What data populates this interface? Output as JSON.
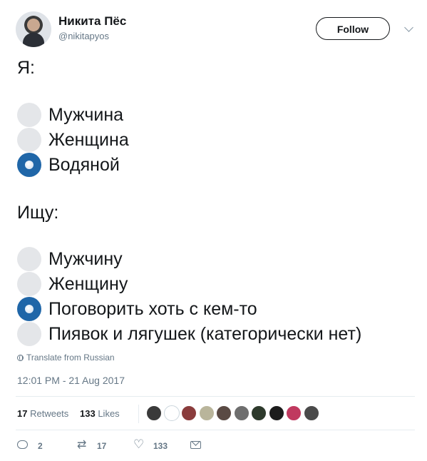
{
  "author": {
    "display_name": "Никита Пёс",
    "handle": "@nikitapyos",
    "follow_label": "Follow"
  },
  "tweet": {
    "heading_1": "Я:",
    "group_1": [
      {
        "label": "Мужчина",
        "checked": false
      },
      {
        "label": "Женщина",
        "checked": false
      },
      {
        "label": "Водяной",
        "checked": true
      }
    ],
    "heading_2": "Ищу:",
    "group_2": [
      {
        "label": "Мужчину",
        "checked": false
      },
      {
        "label": "Женщину",
        "checked": false
      },
      {
        "label": "Поговорить хоть с кем-то",
        "checked": true
      },
      {
        "label": "Пиявок и лягушек (категорически нет)",
        "checked": false
      }
    ],
    "translate_label": "Translate from Russian",
    "timestamp": "12:01 PM - 21 Aug 2017"
  },
  "stats": {
    "retweets_count": "17",
    "retweets_label": "Retweets",
    "likes_count": "133",
    "likes_label": "Likes",
    "likers_colors": [
      "#3a3a3a",
      "#ffffff",
      "#8a3c3c",
      "#b9b59b",
      "#5a4a44",
      "#6e6e6e",
      "#2e3a2c",
      "#1c1c1c",
      "#c0395f",
      "#4a4a4a"
    ]
  },
  "actions": {
    "reply_count": "2",
    "retweet_count": "17",
    "like_count": "133"
  },
  "colors": {
    "radio_checked": "#1f66a8",
    "radio_unchecked": "#e4e6e9",
    "muted_text": "#657786"
  }
}
